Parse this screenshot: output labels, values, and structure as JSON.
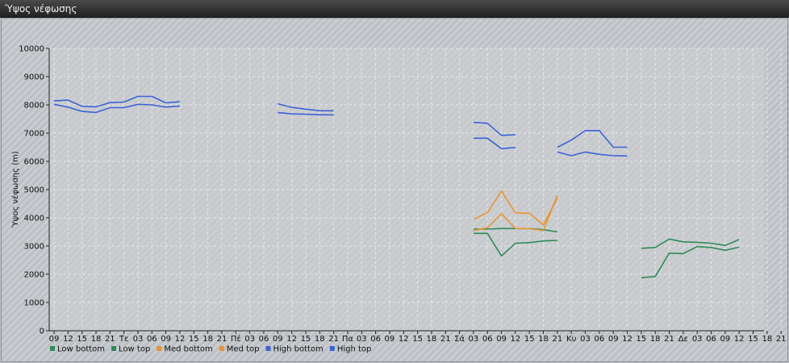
{
  "window": {
    "title": "Ύψος νέφωσης"
  },
  "colors": {
    "low_bottom": "#2e8b57",
    "low_top": "#2e8b57",
    "med_bottom": "#e8952f",
    "med_top": "#e8952f",
    "high_bottom": "#3b63d6",
    "high_top": "#3b63d6"
  },
  "chart_data": {
    "type": "line",
    "ylabel": "Ύψος νέφωσης (m)",
    "ylim": [
      0,
      10000
    ],
    "yticks": [
      0,
      1000,
      2000,
      3000,
      4000,
      5000,
      6000,
      7000,
      8000,
      9000,
      10000
    ],
    "grid": true,
    "legend_position": "bottom-left",
    "x_labels": [
      "09",
      "12",
      "15",
      "18",
      "21",
      "Τε",
      "03",
      "06",
      "09",
      "12",
      "15",
      "18",
      "21",
      "Πέ",
      "03",
      "06",
      "09",
      "12",
      "15",
      "18",
      "21",
      "Πα",
      "03",
      "06",
      "09",
      "12",
      "15",
      "18",
      "21",
      "Σά",
      "03",
      "06",
      "09",
      "12",
      "15",
      "18",
      "21",
      "Κυ",
      "03",
      "06",
      "09",
      "12",
      "15",
      "18",
      "21",
      "Δε",
      "03",
      "06",
      "09",
      "12",
      "15",
      "18",
      "21"
    ],
    "series": [
      {
        "name": "Low bottom",
        "color_key": "low_bottom",
        "values": [
          null,
          null,
          null,
          null,
          null,
          null,
          null,
          null,
          null,
          null,
          null,
          null,
          null,
          null,
          null,
          null,
          null,
          null,
          null,
          null,
          null,
          null,
          null,
          null,
          null,
          null,
          null,
          null,
          null,
          null,
          3450,
          3450,
          2650,
          3100,
          3120,
          3180,
          3200,
          null,
          null,
          null,
          null,
          null,
          1880,
          1920,
          2750,
          2730,
          2980,
          2950,
          2850,
          2960,
          null,
          null,
          null
        ]
      },
      {
        "name": "Low top",
        "color_key": "low_top",
        "values": [
          null,
          null,
          null,
          null,
          null,
          null,
          null,
          null,
          null,
          null,
          null,
          null,
          null,
          null,
          null,
          null,
          null,
          null,
          null,
          null,
          null,
          null,
          null,
          null,
          null,
          null,
          null,
          null,
          null,
          null,
          3600,
          3600,
          3620,
          3620,
          3620,
          3580,
          3500,
          null,
          null,
          null,
          null,
          null,
          2920,
          2950,
          3250,
          3150,
          3130,
          3100,
          3020,
          3230,
          null,
          null,
          null
        ]
      },
      {
        "name": "Med bottom",
        "color_key": "med_bottom",
        "values": [
          null,
          null,
          null,
          null,
          null,
          null,
          null,
          null,
          null,
          null,
          null,
          null,
          null,
          null,
          null,
          null,
          null,
          null,
          null,
          null,
          null,
          null,
          null,
          null,
          null,
          null,
          null,
          null,
          null,
          null,
          3550,
          3650,
          4150,
          3620,
          3620,
          3550,
          4800,
          null,
          null,
          null,
          null,
          null,
          null,
          null,
          null,
          null,
          null,
          null,
          null,
          null,
          null,
          null,
          null
        ]
      },
      {
        "name": "Med top",
        "color_key": "med_top",
        "values": [
          null,
          null,
          null,
          null,
          null,
          null,
          null,
          null,
          null,
          null,
          null,
          null,
          null,
          null,
          null,
          null,
          null,
          null,
          null,
          null,
          null,
          null,
          null,
          null,
          null,
          null,
          null,
          null,
          null,
          null,
          3950,
          4180,
          4950,
          4170,
          4160,
          3750,
          4700,
          null,
          null,
          null,
          null,
          null,
          null,
          null,
          null,
          null,
          null,
          null,
          null,
          null,
          null,
          null,
          null
        ]
      },
      {
        "name": "High bottom",
        "color_key": "high_bottom",
        "values": [
          8020,
          7920,
          7770,
          7730,
          7900,
          7900,
          8020,
          8000,
          7920,
          7960,
          null,
          null,
          null,
          null,
          null,
          null,
          7730,
          7680,
          7670,
          7650,
          7650,
          null,
          null,
          null,
          null,
          null,
          null,
          null,
          null,
          null,
          6820,
          6820,
          6450,
          6490,
          null,
          null,
          6330,
          6200,
          6330,
          6250,
          6200,
          6190,
          null,
          null,
          null,
          null,
          null,
          null,
          null,
          null,
          null,
          null,
          null
        ]
      },
      {
        "name": "High top",
        "color_key": "high_top",
        "values": [
          8140,
          8170,
          7950,
          7930,
          8080,
          8100,
          8300,
          8300,
          8070,
          8110,
          null,
          null,
          null,
          null,
          null,
          null,
          8040,
          7910,
          7850,
          7790,
          7790,
          null,
          null,
          null,
          null,
          null,
          null,
          null,
          null,
          null,
          7380,
          7350,
          6920,
          6940,
          null,
          null,
          6500,
          6750,
          7090,
          7090,
          6500,
          6500,
          null,
          null,
          null,
          null,
          null,
          null,
          null,
          null,
          null,
          null,
          null
        ]
      }
    ]
  }
}
